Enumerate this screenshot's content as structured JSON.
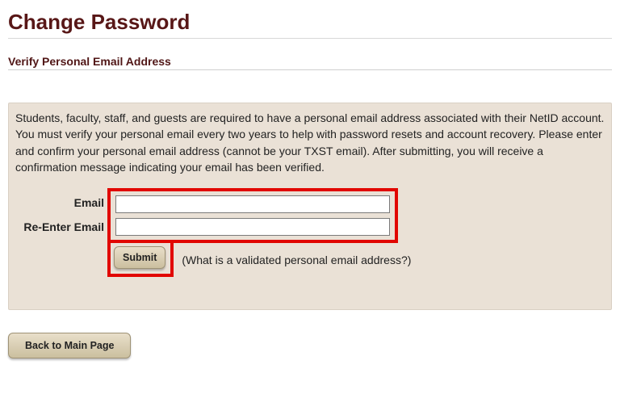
{
  "header": {
    "title": "Change Password",
    "subtitle": "Verify Personal Email Address"
  },
  "panel": {
    "instructions": "Students, faculty, staff, and guests are required to have a personal email address associated with their NetID account. You must verify your personal email every two years to help with password resets and account recovery. Please enter and confirm your personal email address (cannot be your TXST email). After submitting, you will receive a confirmation message indicating your email has been verified.",
    "labels": {
      "email": "Email",
      "reenter": "Re-Enter Email"
    },
    "fields": {
      "email_value": "",
      "reenter_value": ""
    },
    "submit_label": "Submit",
    "help_text": "(What is a validated personal email address?)"
  },
  "footer": {
    "back_label": "Back to Main Page"
  },
  "highlight": {
    "inputs": true,
    "submit": true
  }
}
